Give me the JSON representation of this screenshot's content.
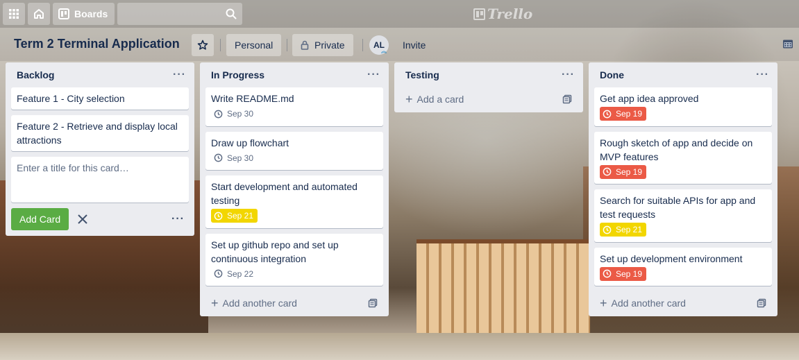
{
  "header": {
    "boards_label": "Boards",
    "logo_text": "Trello"
  },
  "board": {
    "title": "Term 2 Terminal Application",
    "personal_label": "Personal",
    "private_label": "Private",
    "avatar_initials": "AL",
    "invite_label": "Invite"
  },
  "lists": [
    {
      "title": "Backlog",
      "menu": "···",
      "cards": [
        {
          "title": "Feature 1 - City selection"
        },
        {
          "title": "Feature 2 - Retrieve and display local attractions"
        }
      ],
      "composer_placeholder": "Enter a title for this card…",
      "add_button": "Add Card"
    },
    {
      "title": "In Progress",
      "menu": "···",
      "cards": [
        {
          "title": "Write README.md",
          "due": "Sep 30",
          "due_status": "none"
        },
        {
          "title": "Draw up flowchart",
          "due": "Sep 30",
          "due_status": "none"
        },
        {
          "title": "Start development and automated testing",
          "due": "Sep 21",
          "due_status": "yellow"
        },
        {
          "title": "Set up github repo and set up continuous integration",
          "due": "Sep 22",
          "due_status": "none"
        }
      ],
      "add_label": "Add another card"
    },
    {
      "title": "Testing",
      "menu": "···",
      "cards": [],
      "add_label": "Add a card"
    },
    {
      "title": "Done",
      "menu": "···",
      "cards": [
        {
          "title": "Get app idea approved",
          "due": "Sep 19",
          "due_status": "red"
        },
        {
          "title": "Rough sketch of app and decide on MVP features",
          "due": "Sep 19",
          "due_status": "red"
        },
        {
          "title": "Search for suitable APIs for app and test requests",
          "due": "Sep 21",
          "due_status": "yellow"
        },
        {
          "title": "Set up development environment",
          "due": "Sep 19",
          "due_status": "red"
        }
      ],
      "add_label": "Add another card"
    }
  ],
  "colors": {
    "due_red": "#eb5a46",
    "due_yellow": "#f2d600",
    "add_green": "#5aac44",
    "list_bg": "#ebecf0"
  }
}
